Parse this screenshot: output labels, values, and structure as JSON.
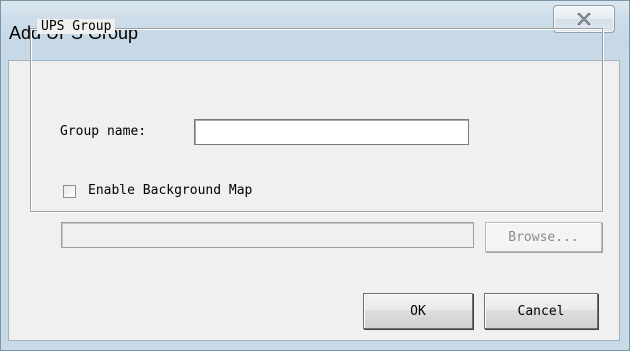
{
  "window": {
    "title": "Add UPS Group",
    "close_icon": "close-icon"
  },
  "groupbox": {
    "label": "UPS Group"
  },
  "group_name": {
    "label": "Group name:",
    "value": "",
    "placeholder": ""
  },
  "background_map": {
    "checkbox_label": "Enable Background Map",
    "checked": false,
    "path_value": "",
    "browse_label": "Browse..."
  },
  "actions": {
    "ok_label": "OK",
    "cancel_label": "Cancel"
  }
}
